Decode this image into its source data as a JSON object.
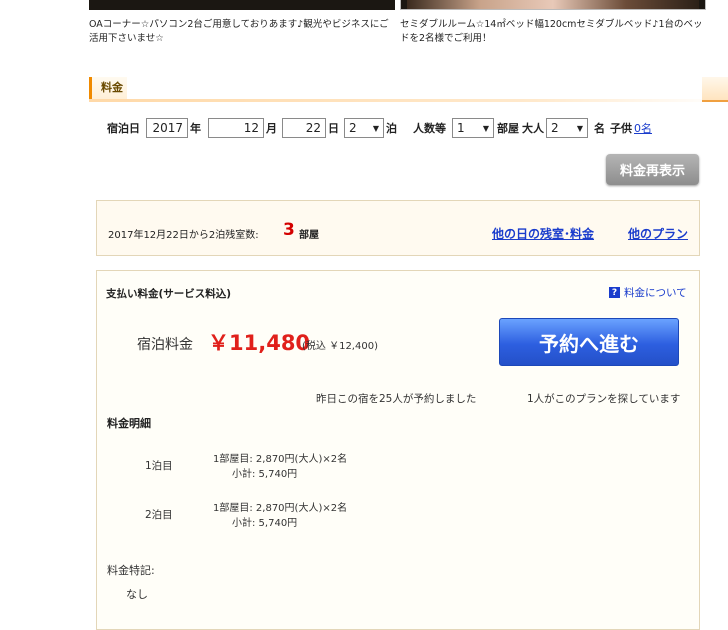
{
  "captions": {
    "left": "OAコーナー☆パソコン2台ご用意しておりあます♪観光やビジネスにご活用下さいませ☆",
    "right": "セミダブルルーム☆14㎡ベッド幅120cmセミダブルベッド♪1台のベッドを2名様でご利用！"
  },
  "section": {
    "title": "料金",
    "accent": "#f08a00"
  },
  "search": {
    "stay_label": "宿泊日",
    "year": "2017",
    "year_unit": "年",
    "month": "12",
    "month_unit": "月",
    "day": "22",
    "day_unit": "日",
    "nights": "2",
    "nights_unit": "泊",
    "guests_label": "人数等",
    "rooms": "1",
    "rooms_unit": "部屋",
    "adult_label": "大人",
    "adults": "2",
    "adult_unit": "名",
    "child_label": "子供",
    "children_link": "0名",
    "redisplay_button": "料金再表示"
  },
  "availability": {
    "text": "2017年12月22日から2泊残室数:",
    "count": "3",
    "unit": "部屋",
    "other_days_link": "他の日の残室･料金",
    "other_plans_link": "他のプラン"
  },
  "payment": {
    "title": "支払い料金(サービス料込)",
    "help_icon": "?",
    "help_link": "料金について",
    "room_label": "宿泊料金",
    "price": "￥11,480",
    "tax_note": "(税込 ￥12,400)",
    "reserve_button": "予約へ進む",
    "info_yesterday": "昨日この宿を25人が予約しました",
    "info_searching": "1人がこのプランを探しています",
    "price_color": "#e0201b",
    "button_color": "#2d5fe0"
  },
  "breakdown": {
    "title": "料金明細",
    "nights": [
      {
        "label": "1泊目",
        "line1": "1部屋目: 2,870円(大人)×2名",
        "line2": "小計: 5,740円"
      },
      {
        "label": "2泊目",
        "line1": "1部屋目: 2,870円(大人)×2名",
        "line2": "小計: 5,740円"
      }
    ]
  },
  "notes": {
    "title": "料金特記:",
    "value": "なし"
  }
}
